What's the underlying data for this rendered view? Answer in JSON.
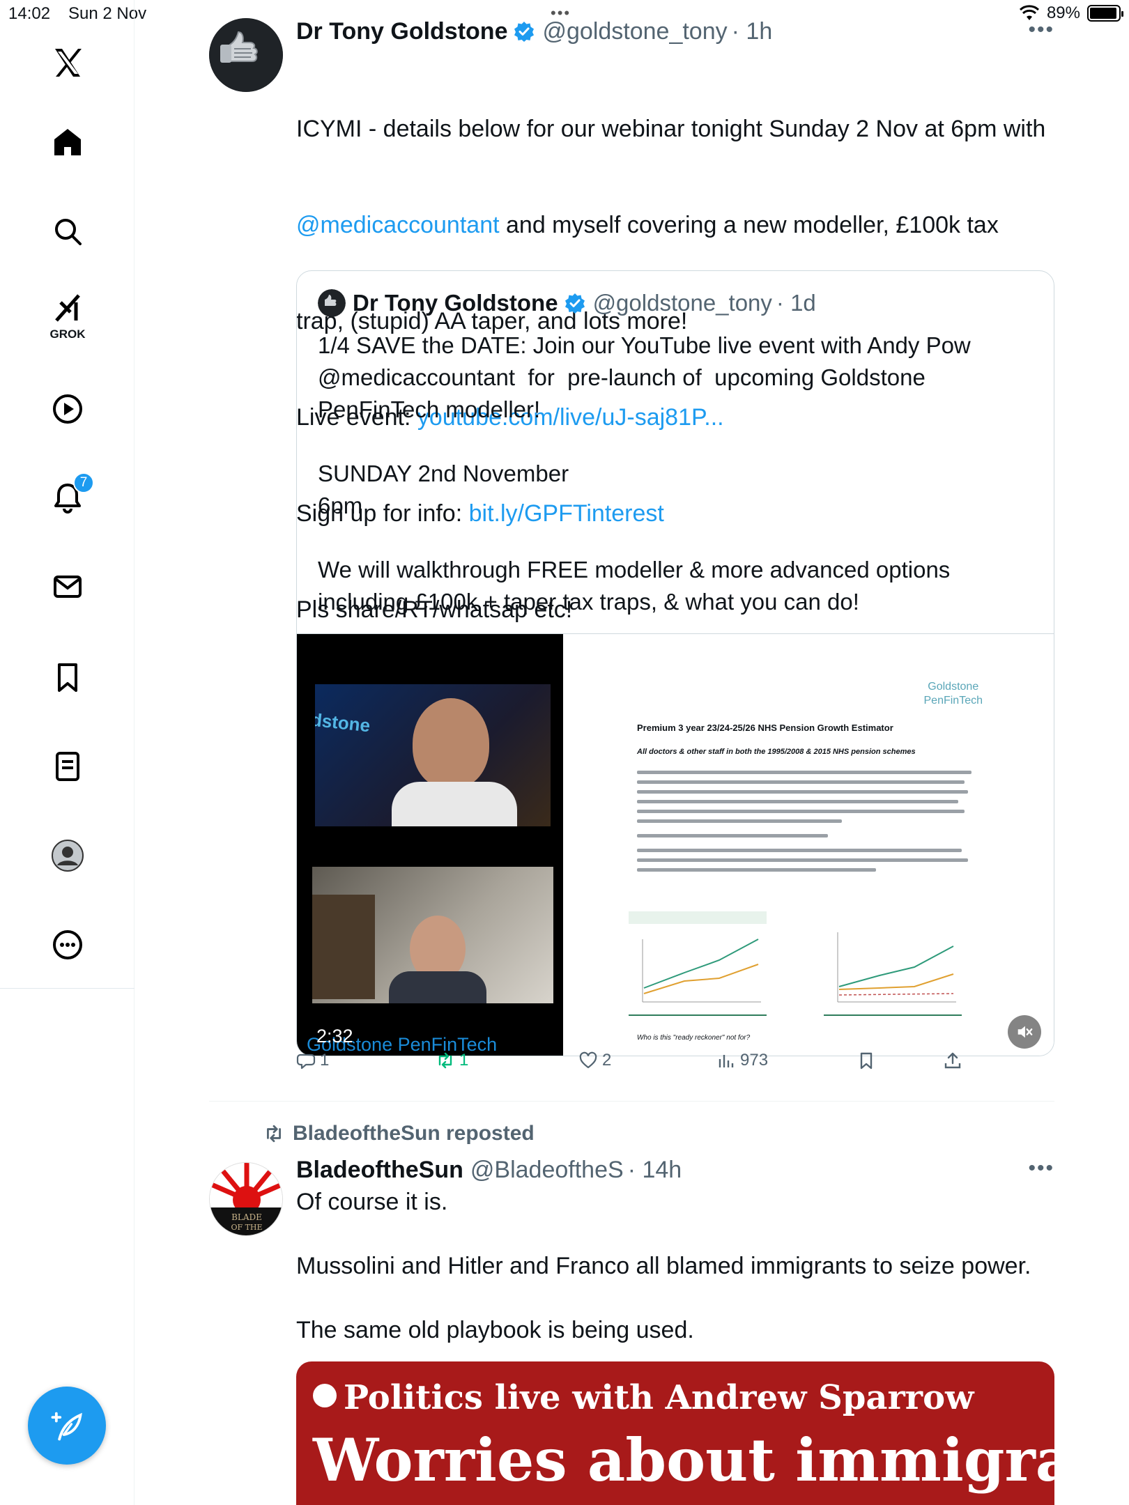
{
  "status_bar": {
    "time": "14:02",
    "date": "Sun 2 Nov",
    "battery": "89%",
    "dots": "•••"
  },
  "sidebar": {
    "notifications_badge": "7",
    "grok_label": "GROK"
  },
  "post1": {
    "name": "Dr Tony Goldstone",
    "handle": "@goldstone_tony",
    "age": "· 1h",
    "more": "•••",
    "text_l1": "ICYMI - details below for our webinar tonight Sunday 2 Nov at 6pm with",
    "mention": "@medicaccountant",
    "text_l2_rest": " and myself covering a new modeller, £100k tax",
    "text_l3": "trap, (stupid) AA taper, and lots more!",
    "live_label": "Live event: ",
    "live_link": "youtube.com/live/uJ-saj81P...",
    "signup_label": "Sign up for info: ",
    "signup_link": "bit.ly/GPFTinterest",
    "text_last": "Pls share/RT/whatsap etc!",
    "quote": {
      "name": "Dr Tony Goldstone",
      "handle": "@goldstone_tony",
      "age": "· 1d",
      "text": "1/4 SAVE the DATE: Join our YouTube live event with Andy Pow\n@medicaccountant  for  pre-launch of  upcoming Goldstone\nPenFinTech modeller!\n\nSUNDAY 2nd November\n6pm\n\nWe will walkthrough FREE modeller & more advanced options\nincluding £100k + taper tax traps, & what you can do!"
    },
    "video": {
      "time": "2:32",
      "brand_overlay": "Goldstone PenFinTech",
      "doc_brand_l1": "Goldstone",
      "doc_brand_l2": "PenFinTech",
      "doc_title": "Premium 3 year 23/24-25/26 NHS Pension Growth Estimator",
      "doc_subtitle": "All doctors & other staff in both the 1995/2008 & 2015 NHS pension schemes",
      "doc_footer": "Who is this \"ready reckoner\" not for?"
    },
    "actions": {
      "replies": "1",
      "reposts": "1",
      "likes": "2",
      "views": "973"
    }
  },
  "post2": {
    "reposted_by": "BladeoftheSun reposted",
    "name": "BladeoftheSun",
    "handle": "@BladeoftheS",
    "age": "· 14h",
    "more": "•••",
    "avatar_text": "BLADE OF THE",
    "text": "Of course it is.\n\nMussolini and Hitler and Franco all blamed immigrants to seize power.\n\nThe same old playbook is being used.",
    "embed_kicker": "Politics live with Andrew Sparrow",
    "embed_headline": "Worries about immigration"
  },
  "colors": {
    "accent": "#1d9bf0",
    "repost_green": "#00ba7c",
    "text": "#0f1419",
    "muted": "#536471",
    "embed_red": "#a81a1a"
  }
}
